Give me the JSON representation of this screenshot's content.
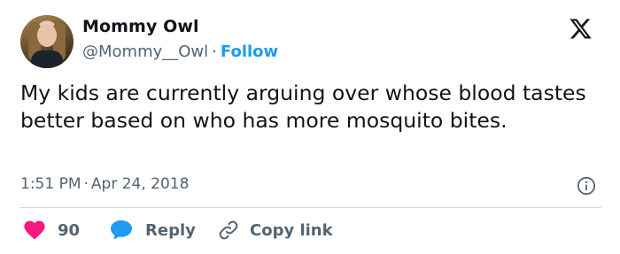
{
  "author": {
    "name": "Mommy Owl",
    "handle": "@Mommy__Owl",
    "separator": "·",
    "follow_label": "Follow"
  },
  "tweet": {
    "text": "My kids are currently arguing over whose blood tastes better based on who has more mosquito bites.",
    "time": "1:51 PM",
    "separator": "·",
    "date": "Apr 24, 2018"
  },
  "actions": {
    "like_count": "90",
    "reply_label": "Reply",
    "copy_label": "Copy link"
  },
  "icons": {
    "logo": "x-logo-icon",
    "info": "info-icon",
    "like": "heart-icon",
    "reply": "speech-bubble-icon",
    "copy": "link-icon"
  },
  "colors": {
    "accent": "#1d9bf0",
    "like": "#f91880",
    "text": "#0f1419",
    "muted": "#536471",
    "divider": "#cfd9de"
  }
}
